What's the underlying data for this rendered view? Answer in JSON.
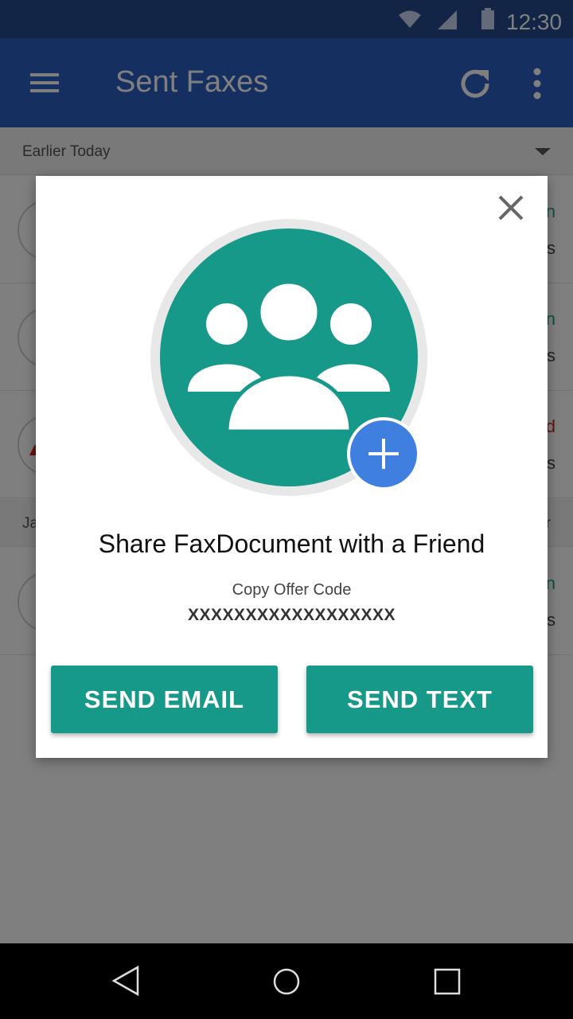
{
  "status_bar": {
    "time": "12:30",
    "icons": [
      "wifi-icon",
      "cell-signal-icon",
      "battery-icon"
    ],
    "color": "#254a8c"
  },
  "app_bar": {
    "title": "Sent Faxes",
    "icons": [
      "menu-icon",
      "refresh-icon",
      "more-vert-icon"
    ],
    "color": "#2d5ec2"
  },
  "list": {
    "sections": [
      {
        "label": "Earlier Today"
      },
      {
        "label": "Ja"
      }
    ],
    "rows": [
      {
        "status": "n",
        "meta": "s"
      },
      {
        "status": "n",
        "meta": "s"
      },
      {
        "status": "d",
        "meta": "s",
        "status_color": "#d32121"
      },
      {
        "status": "n",
        "meta": "s"
      }
    ],
    "section_right_partial": "r"
  },
  "dialog": {
    "title": "Share FaxDocument with a Friend",
    "offer_label": "Copy Offer Code",
    "offer_code": "XXXXXXXXXXXXXXXXXX",
    "send_email_label": "SEND EMAIL",
    "send_text_label": "SEND TEXT",
    "hero_icon": "group-add-icon",
    "accent_color": "#17998a",
    "badge_color": "#3f7fe0"
  },
  "nav_bar": {
    "icons": [
      "back-icon",
      "home-icon",
      "recents-icon"
    ]
  }
}
